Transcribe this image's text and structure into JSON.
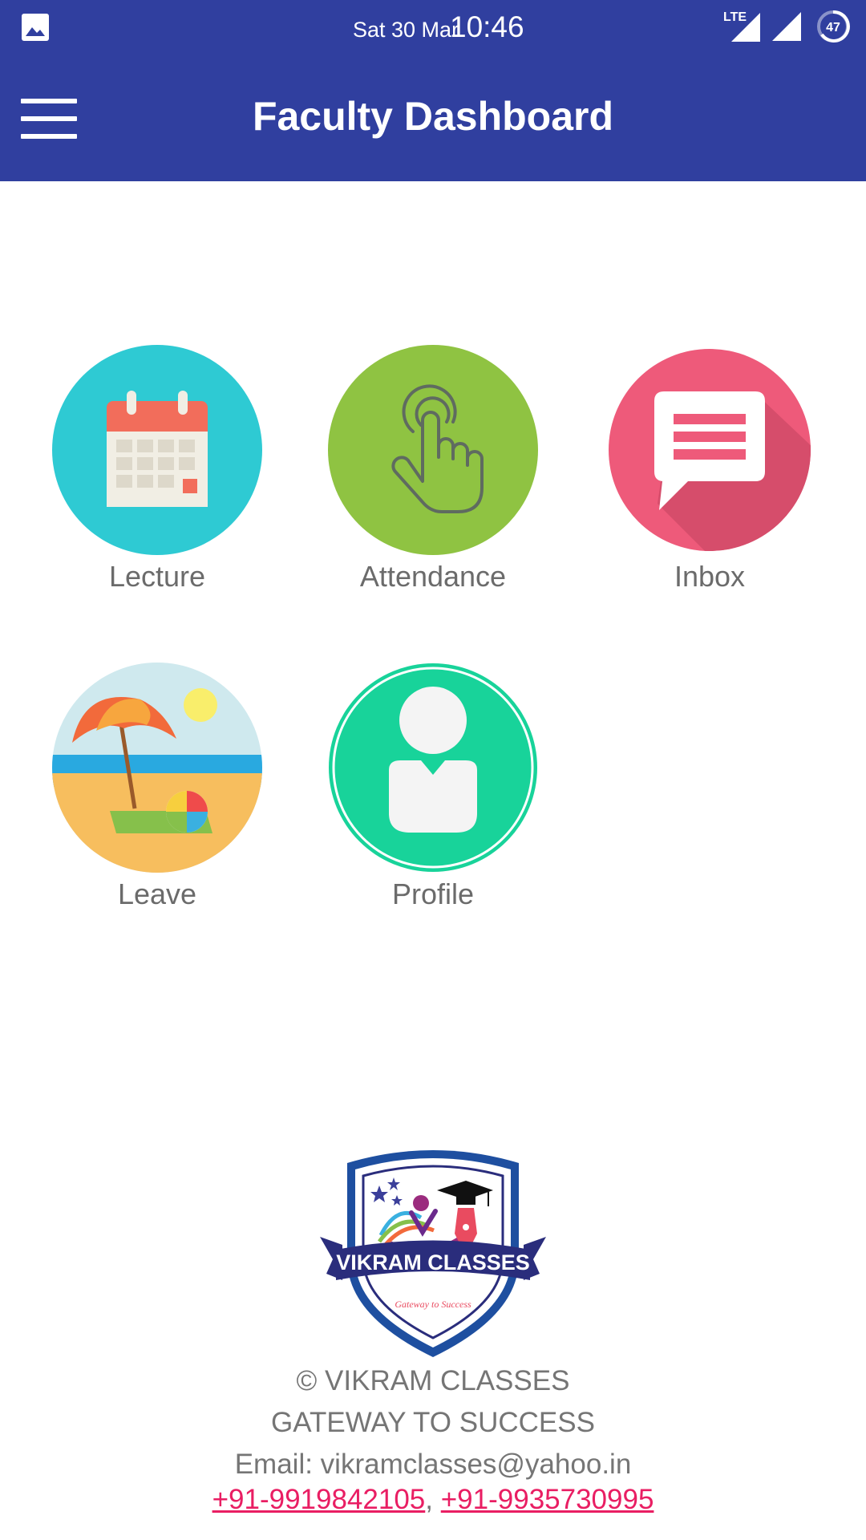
{
  "status_bar": {
    "date": "Sat 30 Mar",
    "time": "10:46",
    "network": "LTE",
    "battery": "47",
    "icons": [
      "gallery-icon",
      "lte-signal-icon",
      "signal-icon",
      "battery-icon"
    ]
  },
  "app_bar": {
    "title": "Faculty Dashboard",
    "menu_icon": "hamburger-menu-icon"
  },
  "tiles": [
    {
      "label": "Lecture",
      "icon": "calendar-icon",
      "color": "#2ECAD3"
    },
    {
      "label": "Attendance",
      "icon": "touch-hand-icon",
      "color": "#8FC342"
    },
    {
      "label": "Inbox",
      "icon": "chat-message-icon",
      "color": "#EE5A7A"
    },
    {
      "label": "Leave",
      "icon": "beach-umbrella-icon",
      "color": "#F7BE5E"
    },
    {
      "label": "Profile",
      "icon": "user-avatar-icon",
      "color": "#18D39A"
    }
  ],
  "footer": {
    "logo_text": "VIKRAM CLASSES",
    "logo_tagline": "Gateway to Success",
    "copyright": "© VIKRAM CLASSES",
    "tagline": "GATEWAY TO SUCCESS",
    "email": "Email: vikramclasses@yahoo.in",
    "phone1": "+91-9919842105",
    "phone_separator": ",",
    "phone2": "+91-9935730995"
  },
  "colors": {
    "primary": "#303F9F",
    "label_text": "#6b6b6b",
    "link": "#E91E63"
  }
}
